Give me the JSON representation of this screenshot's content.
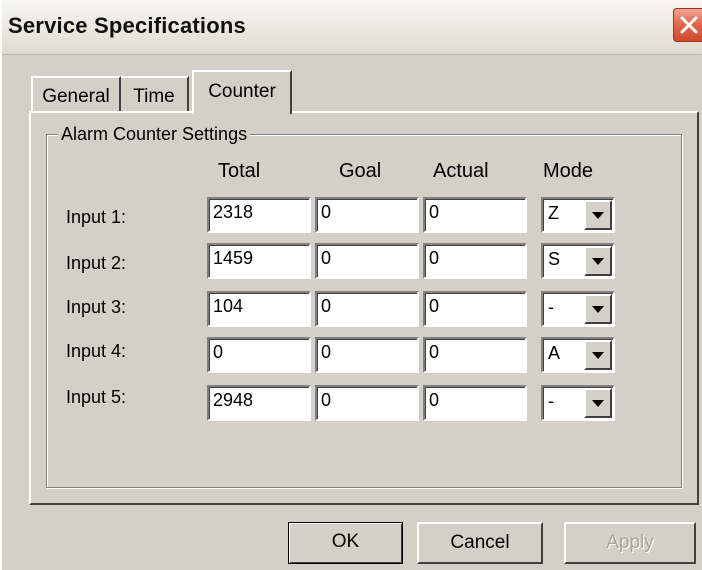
{
  "window": {
    "title": "Service Specifications"
  },
  "tabs": [
    {
      "label": "General",
      "active": false
    },
    {
      "label": "Time",
      "active": false
    },
    {
      "label": "Counter",
      "active": true
    }
  ],
  "group": {
    "legend": "Alarm Counter Settings",
    "columns": {
      "total": "Total",
      "goal": "Goal",
      "actual": "Actual",
      "mode": "Mode"
    },
    "rows": [
      {
        "label": "Input 1:",
        "total": "2318",
        "goal": "0",
        "actual": "0",
        "mode": "Z"
      },
      {
        "label": "Input 2:",
        "total": "1459",
        "goal": "0",
        "actual": "0",
        "mode": "S"
      },
      {
        "label": "Input 3:",
        "total": "104",
        "goal": "0",
        "actual": "0",
        "mode": "-"
      },
      {
        "label": "Input 4:",
        "total": "0",
        "goal": "0",
        "actual": "0",
        "mode": "A"
      },
      {
        "label": "Input 5:",
        "total": "2948",
        "goal": "0",
        "actual": "0",
        "mode": "-"
      }
    ]
  },
  "buttons": {
    "ok": "OK",
    "cancel": "Cancel",
    "apply": "Apply"
  },
  "icons": {
    "close": "close-icon",
    "dropdown": "chevron-down-icon"
  },
  "colors": {
    "window_bg": "#d4d0c8",
    "close_button": "#e06a4d",
    "disabled_text": "#a8a49c"
  }
}
